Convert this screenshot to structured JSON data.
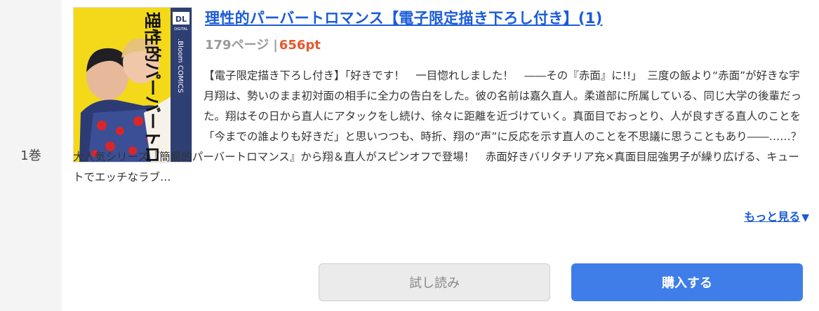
{
  "volume": {
    "label": "1巻"
  },
  "book": {
    "title": "理性的パーバートロマンス【電子限定描き下ろし付き】(1)",
    "pages": "179ページ",
    "separator": "|",
    "price": "656pt",
    "description": "【電子限定描き下ろし付き】「好きです！　一目惚れしました！　――その『赤面』に!!」　三度の飯より“赤面”が好きな宇月翔は、勢いのまま初対面の相手に全力の告白をした。彼の名前は嘉久直人。柔道部に所属している、同じ大学の後輩だった。翔はその日から直人にアタックをし続け、徐々に距離を近づけていく。真面目でおっとり、人が良すぎる直人のことを「今までの誰よりも好きだ」と思いつつも、時折、翔の“声”に反応を示す直人のことを不思議に思うこともあり――……？　大人気シリーズ『簡易的パーバートロマンス』から翔＆直人がスピンオフで登場！　赤面好きバリタチリア充×真面目屈強男子が繰り広げる、キュートでエッチなラブ…",
    "more_label": "もっと見る",
    "more_arrow": "▼"
  },
  "cover": {
    "title_text": "理性的パーバートロマンス",
    "badge": "DL",
    "badge_sub": "DIGITAL",
    "imprint": ".Bloom COMICS",
    "colors": {
      "background": "#f2d400",
      "spine": "#2d3f73"
    }
  },
  "buttons": {
    "trial": "試し読み",
    "buy": "購入する"
  },
  "colors": {
    "link": "#1a5bd8",
    "price": "#e8572c",
    "buy": "#3f7ee8",
    "trial_bg": "#ebebeb"
  }
}
